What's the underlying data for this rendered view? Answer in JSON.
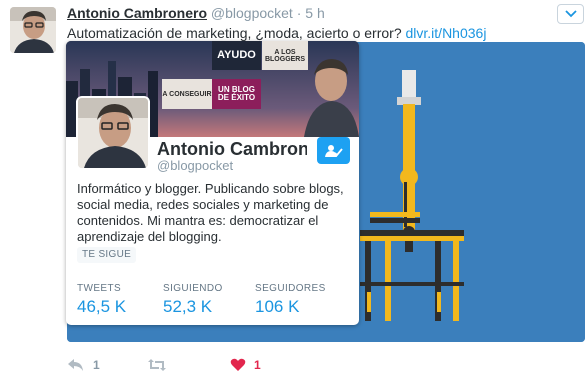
{
  "tweet": {
    "author_name": "Antonio Cambronero",
    "author_handle": "@blogpocket",
    "separator": "·",
    "time": "5 h",
    "text_prefix": "Automatización de marketing, ¿moda, acierto o error?",
    "text_link": "dlvr.it/Nh036j"
  },
  "actions": {
    "reply_count": "1",
    "retweet_count": "",
    "like_count": "1"
  },
  "profile_card": {
    "name": "Antonio Cambronero",
    "handle": "@blogpocket",
    "bio": "Informático y blogger. Publicando sobre blogs, social media, redes sociales y marketing de contenidos. Mi mantra es: democratizar el aprendizaje del blogging.",
    "follows_you": "TE SIGUE",
    "banner": {
      "word1": "AYUDO",
      "word2": "A LOS BLOGGERS",
      "word3": "A CONSEGUIR",
      "word4": "UN BLOG DE ÉXITO"
    },
    "stats": [
      {
        "label": "TWEETS",
        "value": "46,5 K"
      },
      {
        "label": "SIGUIENDO",
        "value": "52,3 K"
      },
      {
        "label": "SEGUIDORES",
        "value": "106 K"
      }
    ]
  },
  "colors": {
    "link": "#1b95e0",
    "like": "#e2264d",
    "media_bg": "#3b7fbc",
    "follow_button": "#1da1f2"
  },
  "icons": [
    "caret-down-icon",
    "reply-icon",
    "retweet-icon",
    "heart-icon",
    "follow-user-icon"
  ]
}
